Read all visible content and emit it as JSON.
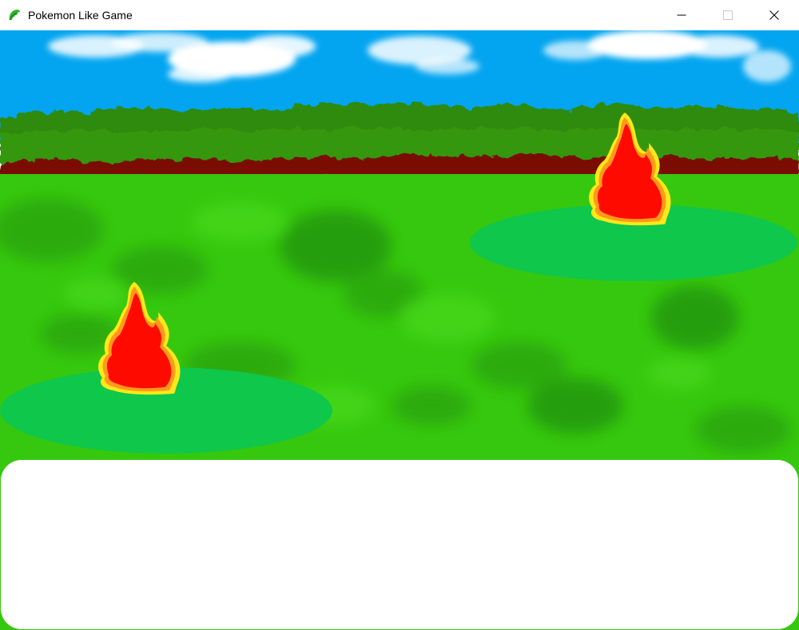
{
  "window": {
    "title": "Pokemon Like Game",
    "app_icon": "green-leaf-icon",
    "controls": {
      "minimize": "minimize-icon",
      "maximize": "maximize-icon",
      "close": "close-icon"
    }
  },
  "scene": {
    "colors": {
      "sky": "#03a5f0",
      "cloud": "#ffffff",
      "bushes": "#2e8b0a",
      "dirt": "#7a0a04",
      "grass": "#36c80e",
      "grass_dark": "#2aa50a",
      "platform": "#0fc74a",
      "flame_outer": "#ff9a1a",
      "flame_edge": "#ffe81a",
      "flame_inner": "#ff0a00"
    },
    "opponent": {
      "sprite": "flame-creature-icon"
    },
    "player": {
      "sprite": "flame-creature-icon"
    }
  },
  "dialog": {
    "text": ""
  }
}
